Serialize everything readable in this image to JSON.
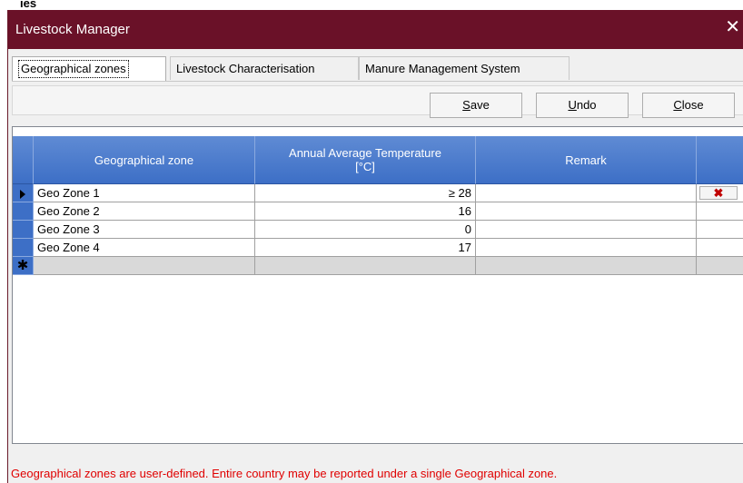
{
  "background_label": "ies",
  "window": {
    "title": "Livestock Manager",
    "close_glyph": "✕"
  },
  "tabs": [
    {
      "label": "Geographical zones",
      "active": true
    },
    {
      "label": "Livestock Characterisation",
      "active": false
    },
    {
      "label": "Manure Management System",
      "active": false
    }
  ],
  "toolbar": {
    "save": {
      "mnemonic": "S",
      "rest": "ave"
    },
    "undo": {
      "mnemonic": "U",
      "rest": "ndo"
    },
    "close": {
      "mnemonic": "C",
      "rest": "lose"
    }
  },
  "grid": {
    "columns": [
      {
        "label": "Geographical zone"
      },
      {
        "label": "Annual Average Temperature\n[°C]"
      },
      {
        "label": "Remark"
      },
      {
        "label": ""
      }
    ],
    "rows": [
      {
        "zone": "Geo Zone 1",
        "temperature": "≥ 28",
        "remark": "",
        "current": true,
        "delete_glyph": "✖"
      },
      {
        "zone": "Geo Zone 2",
        "temperature": "16",
        "remark": "",
        "current": false
      },
      {
        "zone": "Geo Zone 3",
        "temperature": "0",
        "remark": "",
        "current": false
      },
      {
        "zone": "Geo Zone 4",
        "temperature": "17",
        "remark": "",
        "current": false
      }
    ],
    "new_row_glyph": "✱"
  },
  "footer_note": "Geographical zones are user-defined. Entire country may be reported under a single Geographical zone.",
  "colors": {
    "titlebar": "#6a1128",
    "header": "#3d6fc6",
    "note": "#e00000"
  }
}
